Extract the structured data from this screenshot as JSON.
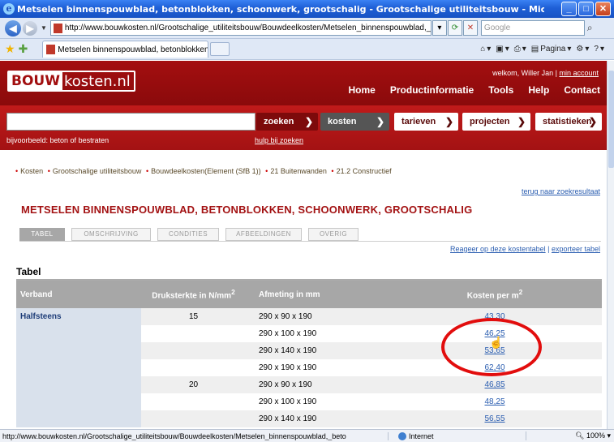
{
  "browser": {
    "window_title": "Metselen binnenspouwblad, betonblokken, schoonwerk, grootschalig - Grootschalige utiliteitsbouw - Microsoft Internet Explorer p",
    "url": "http://www.bouwkosten.nl/Grootschalige_utiliteitsbouw/Bouwdeelkosten/Metselen_binnenspouwblad,_betonblokken,_sch",
    "search_placeholder": "Google",
    "tab_title": "Metselen binnenspouwblad, betonblokken, schoonwer...",
    "commands": {
      "page": "Pagina",
      "tools": ""
    },
    "status_url": "http://www.bouwkosten.nl/Grootschalige_utiliteitsbouw/Bouwdeelkosten/Metselen_binnenspouwblad,_beto",
    "status_zone": "Internet",
    "status_zoom": "100%"
  },
  "site": {
    "logo_bouw": "BOUW",
    "logo_rest": "kosten.nl",
    "welcome": "welkom, Willer Jan |",
    "account_link": "min account",
    "nav": [
      "Home",
      "Productinformatie",
      "Tools",
      "Help",
      "Contact"
    ]
  },
  "search": {
    "placeholder": "",
    "zoeken": "zoeken",
    "kosten": "kosten",
    "tarieven": "tarieven",
    "projecten": "projecten",
    "statistieken": "statistieken",
    "hint": "bijvoorbeeld: beton of bestraten",
    "hulp": "hulp bij zoeken"
  },
  "breadcrumb": [
    "Kosten",
    "Grootschalige utiliteitsbouw",
    "Bouwdeelkosten(Element (SfB 1))",
    "21 Buitenwanden",
    "21.2 Constructief"
  ],
  "terug": "terug naar zoekresultaat",
  "page_title": "METSELEN BINNENSPOUWBLAD, BETONBLOKKEN, SCHOONWERK, GROOTSCHALIG",
  "tabs": [
    "TABEL",
    "OMSCHRIJVING",
    "CONDITIES",
    "AFBEELDINGEN",
    "OVERIG"
  ],
  "reageer": "Reageer op deze kostentabel",
  "exporteer": "exporteer tabel",
  "table": {
    "heading": "Tabel",
    "columns": {
      "verband": "Verband",
      "druk": "Druksterkte in N/mm",
      "druk_sup": "2",
      "afmeting": "Afmeting in mm",
      "kosten": "Kosten per m",
      "kosten_sup": "2"
    },
    "rows": [
      {
        "verband": "Halfsteens",
        "druk": "15",
        "afmeting": "290 x 90 x 190",
        "kosten": "43,30"
      },
      {
        "verband": "",
        "druk": "",
        "afmeting": "290 x 100 x 190",
        "kosten": "46,25"
      },
      {
        "verband": "",
        "druk": "",
        "afmeting": "290 x 140 x 190",
        "kosten": "53,65"
      },
      {
        "verband": "",
        "druk": "",
        "afmeting": "290 x 190 x 190",
        "kosten": "62,40"
      },
      {
        "verband": "",
        "druk": "20",
        "afmeting": "290 x 90 x 190",
        "kosten": "46,85"
      },
      {
        "verband": "",
        "druk": "",
        "afmeting": "290 x 100 x 190",
        "kosten": "48,25"
      },
      {
        "verband": "",
        "druk": "",
        "afmeting": "290 x 140 x 190",
        "kosten": "56,55"
      }
    ]
  },
  "colors": {
    "brand_red": "#a31213",
    "annotation": "#e20d0d",
    "link": "#2a5db0"
  }
}
